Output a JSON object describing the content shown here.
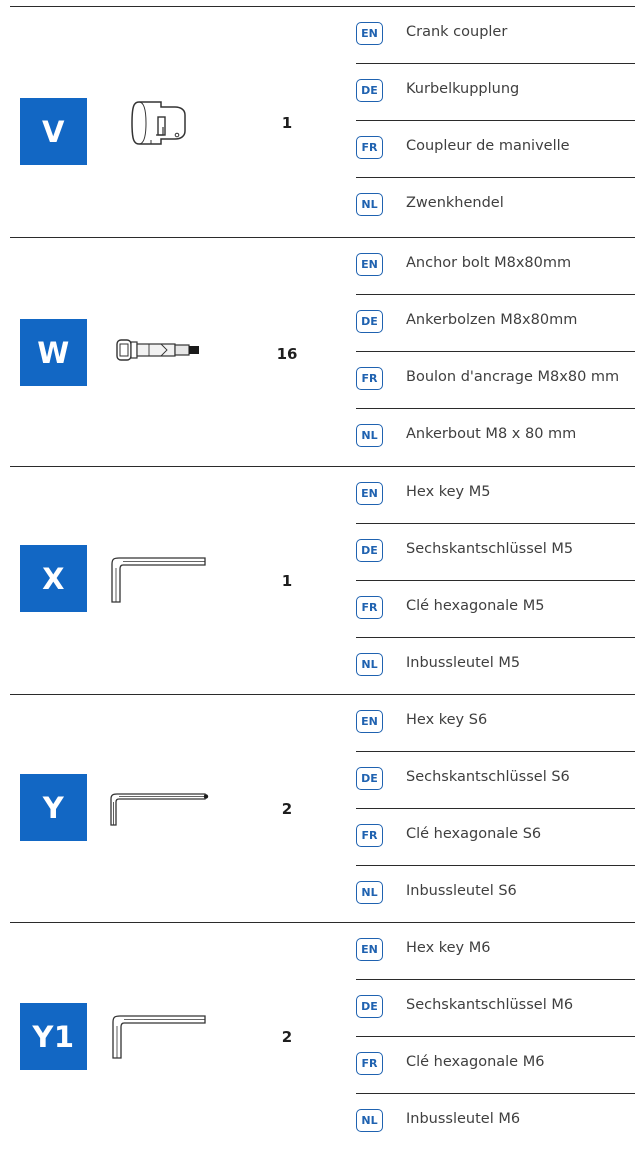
{
  "parts": [
    {
      "letter": "V",
      "icon": "crank-coupler-icon",
      "quantity": "1",
      "names": [
        {
          "code": "EN",
          "text": "Crank coupler"
        },
        {
          "code": "DE",
          "text": "Kurbelkupplung"
        },
        {
          "code": "FR",
          "text": "Coupleur de manivelle"
        },
        {
          "code": "NL",
          "text": "Zwenkhendel"
        }
      ]
    },
    {
      "letter": "W",
      "icon": "anchor-bolt-icon",
      "quantity": "16",
      "names": [
        {
          "code": "EN",
          "text": "Anchor bolt M8x80mm"
        },
        {
          "code": "DE",
          "text": "Ankerbolzen M8x80mm"
        },
        {
          "code": "FR",
          "text": "Boulon d'ancrage M8x80 mm"
        },
        {
          "code": "NL",
          "text": "Ankerbout M8 x 80 mm"
        }
      ]
    },
    {
      "letter": "X",
      "icon": "hex-key-icon",
      "quantity": "1",
      "names": [
        {
          "code": "EN",
          "text": "Hex key M5"
        },
        {
          "code": "DE",
          "text": "Sechskantschlüssel M5"
        },
        {
          "code": "FR",
          "text": "Clé hexagonale M5"
        },
        {
          "code": "NL",
          "text": "Inbussleutel M5"
        }
      ]
    },
    {
      "letter": "Y",
      "icon": "hex-key-icon",
      "quantity": "2",
      "names": [
        {
          "code": "EN",
          "text": "Hex key S6"
        },
        {
          "code": "DE",
          "text": "Sechskantschlüssel S6"
        },
        {
          "code": "FR",
          "text": "Clé hexagonale S6"
        },
        {
          "code": "NL",
          "text": "Inbussleutel S6"
        }
      ]
    },
    {
      "letter": "Y1",
      "icon": "hex-key-icon",
      "quantity": "2",
      "names": [
        {
          "code": "EN",
          "text": "Hex key M6"
        },
        {
          "code": "DE",
          "text": "Sechskantschlüssel M6"
        },
        {
          "code": "FR",
          "text": "Clé hexagonale M6"
        },
        {
          "code": "NL",
          "text": "Inbussleutel M6"
        }
      ]
    }
  ],
  "colors": {
    "badge": "#1267c4",
    "language_code": "#1f62b0",
    "rule": "#2b2b2b",
    "text": "#3f3f3f"
  }
}
